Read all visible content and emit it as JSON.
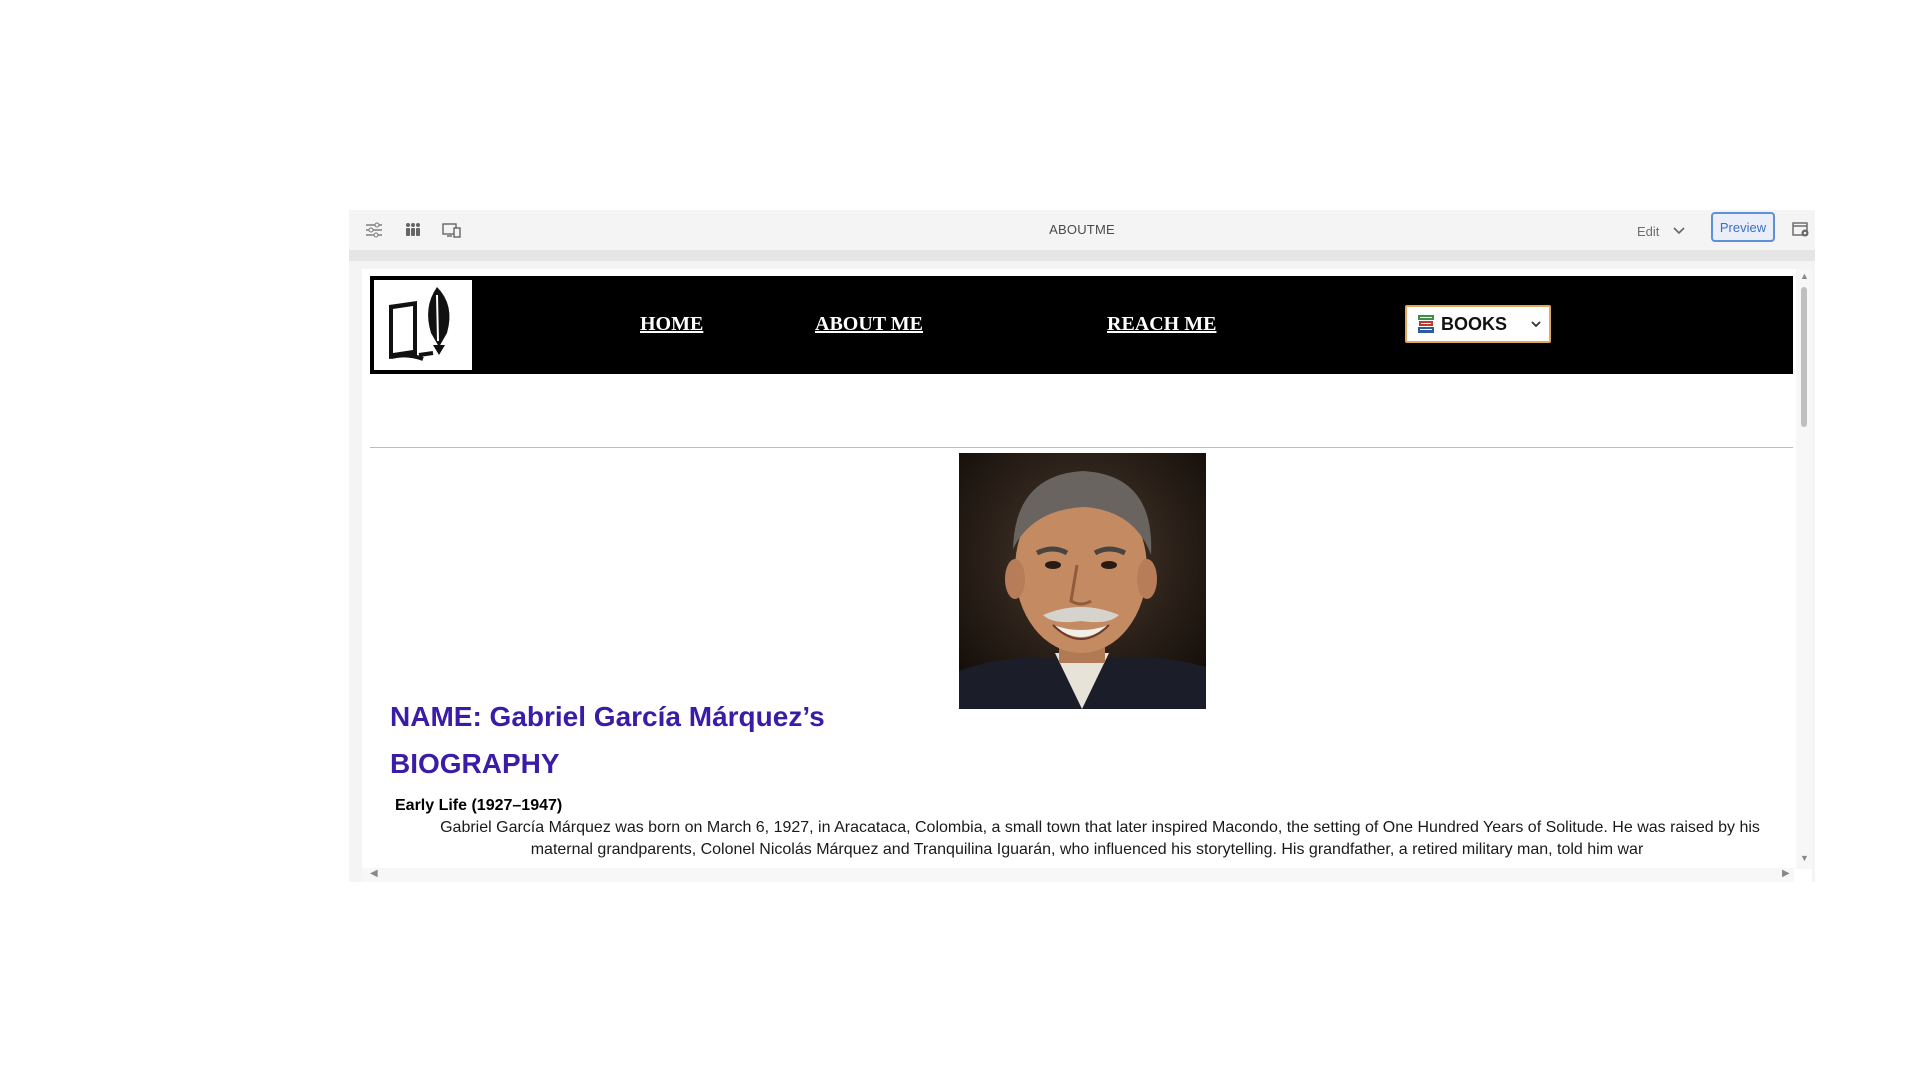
{
  "editor": {
    "title": "ABOUTME",
    "mode_label": "Edit",
    "preview_label": "Preview",
    "icons": [
      "sliders-icon",
      "people-icon",
      "device-preview-icon",
      "page-settings-icon"
    ]
  },
  "site": {
    "nav": {
      "home": "HOME",
      "about": "ABOUT ME",
      "reach": "REACH ME",
      "books": "BOOKS"
    },
    "heading_name": "NAME: Gabriel García Márquez’s",
    "heading_bio": "BIOGRAPHY",
    "section_title": "Early Life (1927–1947)",
    "paragraph": "Gabriel García Márquez was born on March 6, 1927, in Aracataca, Colombia, a small town that later inspired Macondo, the setting of One Hundred Years of Solitude. He was raised by his maternal grandparents, Colonel Nicolás Márquez and Tranquilina Iguarán, who influenced his storytelling. His grandfather, a retired military man, told him war"
  },
  "colors": {
    "heading": "#3a1ca6",
    "nav_bg": "#000000",
    "preview_accent": "#5f8fd6",
    "books_border": "#e3a85c"
  }
}
